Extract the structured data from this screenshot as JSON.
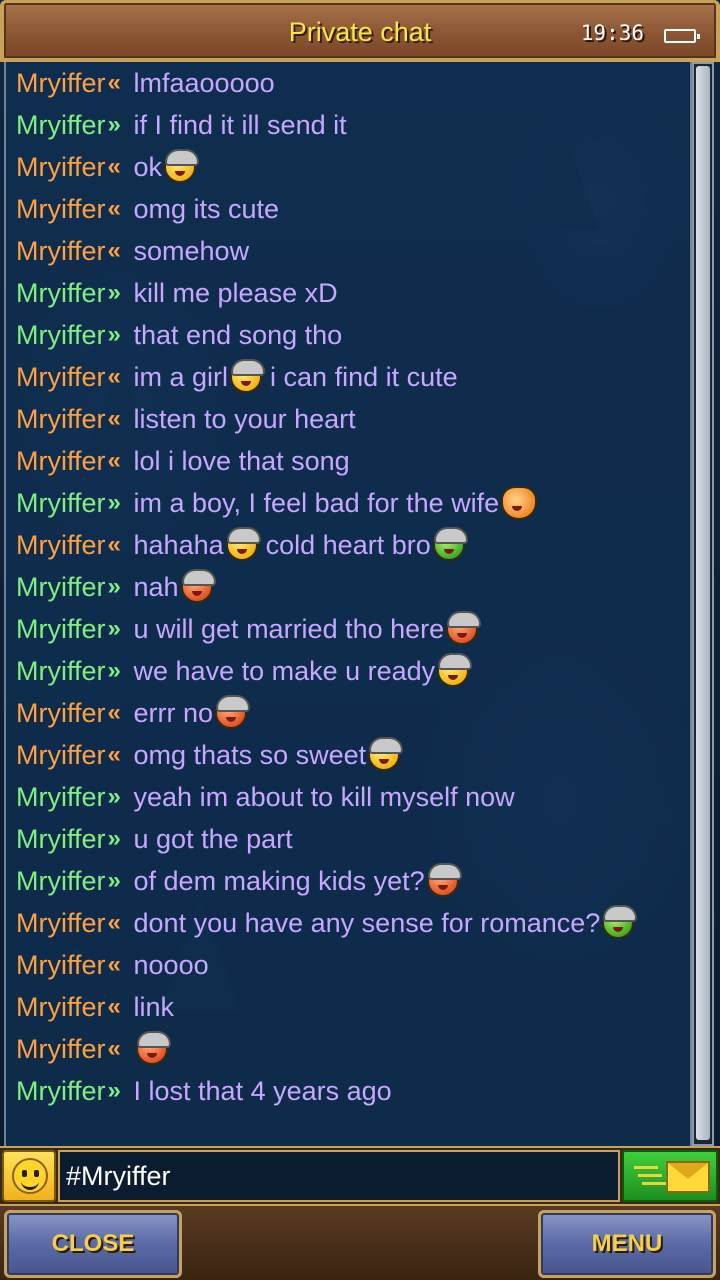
{
  "header": {
    "title": "Private chat",
    "clock": "19:36",
    "battery_icon": "battery-icon"
  },
  "colors": {
    "incoming": "#ffa040",
    "outgoing": "#7ff080",
    "message_text": "#c7a7ff",
    "title": "#f5e94a",
    "button_text": "#f5cf4a"
  },
  "messages": [
    {
      "sender": "Mryiffer",
      "direction": "in",
      "arrow": "«",
      "text": "lmfaaooooo",
      "emoji": ""
    },
    {
      "sender": "Mryiffer",
      "direction": "out",
      "arrow": "»",
      "text": "if I find it ill send it",
      "emoji": ""
    },
    {
      "sender": "Mryiffer",
      "direction": "in",
      "arrow": "«",
      "text": "ok",
      "emoji": "tongue-viking-emoji"
    },
    {
      "sender": "Mryiffer",
      "direction": "in",
      "arrow": "«",
      "text": "omg its cute",
      "emoji": ""
    },
    {
      "sender": "Mryiffer",
      "direction": "in",
      "arrow": "«",
      "text": "somehow",
      "emoji": ""
    },
    {
      "sender": "Mryiffer",
      "direction": "out",
      "arrow": "»",
      "text": "kill me please xD",
      "emoji": ""
    },
    {
      "sender": "Mryiffer",
      "direction": "out",
      "arrow": "»",
      "text": "that end song tho",
      "emoji": ""
    },
    {
      "sender": "Mryiffer",
      "direction": "in",
      "arrow": "«",
      "text": "im a girl",
      "emoji": "tongue-viking-emoji",
      "text2": "i can find it cute"
    },
    {
      "sender": "Mryiffer",
      "direction": "in",
      "arrow": "«",
      "text": "listen to your heart",
      "emoji": ""
    },
    {
      "sender": "Mryiffer",
      "direction": "in",
      "arrow": "«",
      "text": "lol i love that song",
      "emoji": ""
    },
    {
      "sender": "Mryiffer",
      "direction": "out",
      "arrow": "»",
      "text": "im a boy, I feel bad for the wife",
      "emoji": "cat-emoji"
    },
    {
      "sender": "Mryiffer",
      "direction": "in",
      "arrow": "«",
      "text": "hahaha",
      "emoji": "tongue-viking-emoji",
      "text2": "cold heart bro",
      "emoji2": "sick-viking-emoji"
    },
    {
      "sender": "Mryiffer",
      "direction": "out",
      "arrow": "»",
      "text": "nah",
      "emoji": "smirk-viking-emoji"
    },
    {
      "sender": "Mryiffer",
      "direction": "out",
      "arrow": "»",
      "text": "u will get married tho here",
      "emoji": "smirk-viking-emoji"
    },
    {
      "sender": "Mryiffer",
      "direction": "out",
      "arrow": "»",
      "text": "we have to make u ready",
      "emoji": "shocked-viking-emoji"
    },
    {
      "sender": "Mryiffer",
      "direction": "in",
      "arrow": "«",
      "text": "errr no",
      "emoji": "grin-viking-emoji"
    },
    {
      "sender": "Mryiffer",
      "direction": "in",
      "arrow": "«",
      "text": "omg thats so sweet",
      "emoji": "crying-viking-emoji"
    },
    {
      "sender": "Mryiffer",
      "direction": "out",
      "arrow": "»",
      "text": "yeah im about to kill myself now",
      "emoji": ""
    },
    {
      "sender": "Mryiffer",
      "direction": "out",
      "arrow": "»",
      "text": "u got the part",
      "emoji": ""
    },
    {
      "sender": "Mryiffer",
      "direction": "out",
      "arrow": "»",
      "text": "of dem making kids yet?",
      "emoji": "smirk-viking-emoji"
    },
    {
      "sender": "Mryiffer",
      "direction": "in",
      "arrow": "«",
      "text": "dont you have any sense for romance?",
      "emoji": "sick-viking-emoji"
    },
    {
      "sender": "Mryiffer",
      "direction": "in",
      "arrow": "«",
      "text": "noooo",
      "emoji": ""
    },
    {
      "sender": "Mryiffer",
      "direction": "in",
      "arrow": "«",
      "text": "link",
      "emoji": ""
    },
    {
      "sender": "Mryiffer",
      "direction": "in",
      "arrow": "«",
      "text": "",
      "emoji": "grin-viking-emoji"
    },
    {
      "sender": "Mryiffer",
      "direction": "out",
      "arrow": "»",
      "text": "I lost that 4 years ago",
      "emoji": ""
    }
  ],
  "input": {
    "value": "#Mryiffer",
    "emoji_button_icon": "smiley-icon",
    "send_icon": "send-mail-icon"
  },
  "buttons": {
    "close": "CLOSE",
    "menu": "MENU"
  }
}
